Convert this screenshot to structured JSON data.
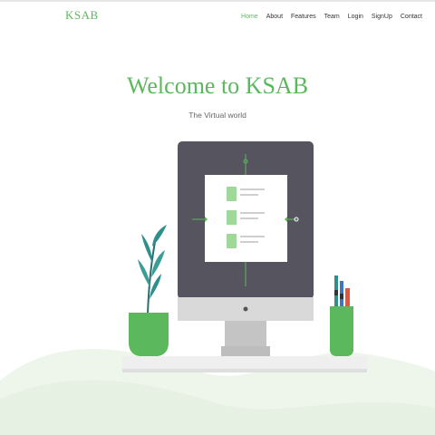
{
  "brand": "KSAB",
  "nav": {
    "home": "Home",
    "about": "About",
    "features": "Features",
    "team": "Team",
    "login": "Login",
    "signup": "SignUp",
    "contact": "Contact",
    "active_color": "#5cb85c"
  },
  "hero": {
    "title": "Welcome to KSAB",
    "subtitle": "The Virtual world"
  },
  "colors": {
    "accent": "#5cb85c",
    "monitor_screen": "#55545f",
    "monitor_bezel": "#d9d9d9"
  }
}
